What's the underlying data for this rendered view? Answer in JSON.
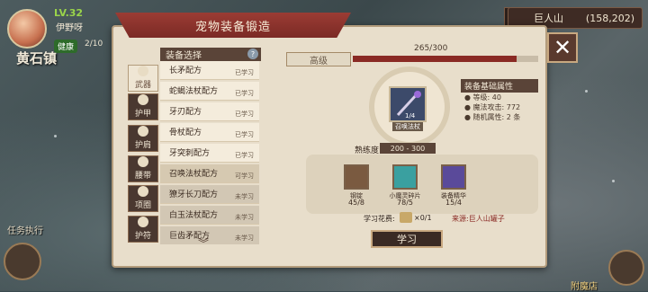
{
  "player": {
    "level": "LV.32",
    "name": "伊野呀",
    "hp_tag": "健康",
    "hp_value": "2/10",
    "town": "黄石镇"
  },
  "location": {
    "name": "巨人山",
    "coords": "(158,202)"
  },
  "quest_label": "任务执行",
  "corner_label": "附魔店",
  "panel_title": "宠物装备锻造",
  "close_label": "✕",
  "tabs": [
    {
      "label": "武器"
    },
    {
      "label": "护甲"
    },
    {
      "label": "护肩"
    },
    {
      "label": "腰带"
    },
    {
      "label": "项圈"
    },
    {
      "label": "护符"
    }
  ],
  "list_header": "装备选择",
  "help_label": "?",
  "items": [
    {
      "name": "长矛配方",
      "status": "已学习"
    },
    {
      "name": "蛇蝎法杖配方",
      "status": "已学习"
    },
    {
      "name": "牙刃配方",
      "status": "已学习"
    },
    {
      "name": "骨杖配方",
      "status": "已学习"
    },
    {
      "name": "牙突刺配方",
      "status": "已学习"
    },
    {
      "name": "召唤法杖配方",
      "status": "可学习"
    },
    {
      "name": "獠牙长刀配方",
      "status": "未学习"
    },
    {
      "name": "白玉法杖配方",
      "status": "未学习"
    },
    {
      "name": "巨齿矛配方",
      "status": "未学习"
    }
  ],
  "grade_label": "高级",
  "progress": {
    "text": "265/300",
    "fraction": 0.883
  },
  "equipment": {
    "name": "召唤法杖",
    "count": "1/4"
  },
  "attributes": {
    "header": "装备基础属性",
    "lines": [
      "● 等级: 40",
      "● 魔法攻击: 772",
      "● 随机属性: 2 条"
    ]
  },
  "proficiency": {
    "label": "熟练度",
    "value": "200 - 300"
  },
  "materials": [
    {
      "name": "钢锭",
      "count": "45/8",
      "color": "#7a5a40"
    },
    {
      "name": "小魔灵碎片",
      "count": "78/5",
      "color": "#3aa0a0"
    },
    {
      "name": "装备精华",
      "count": "15/4",
      "color": "#5a4a9a"
    }
  ],
  "cost": {
    "label": "学习花费:",
    "value": "×0/1"
  },
  "source": "来源:巨人山罐子",
  "learn_button": "学习"
}
